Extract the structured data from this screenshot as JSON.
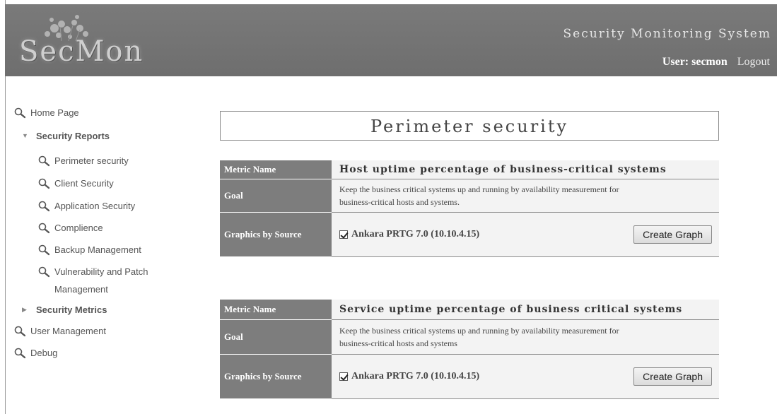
{
  "header": {
    "logo_text": "SecMon",
    "system_title": "Security Monitoring System",
    "user_label": "User: secmon",
    "logout_label": "Logout"
  },
  "sidebar": {
    "items": [
      {
        "label": "Home Page",
        "icon": "magnifier-icon"
      },
      {
        "label": "Security Reports",
        "icon": "triangle-down-icon",
        "expanded": true
      },
      {
        "label": "Perimeter security",
        "icon": "magnifier-icon"
      },
      {
        "label": "Client Security",
        "icon": "magnifier-icon"
      },
      {
        "label": "Application Security",
        "icon": "magnifier-icon"
      },
      {
        "label": "Complience",
        "icon": "magnifier-icon"
      },
      {
        "label": "Backup Management",
        "icon": "magnifier-icon"
      },
      {
        "label": "Vulnerability and Patch",
        "icon": "magnifier-icon"
      },
      {
        "label": "Management"
      },
      {
        "label": "Security Metrics",
        "icon": "triangle-right-icon",
        "expanded": false
      },
      {
        "label": "User Management",
        "icon": "magnifier-icon"
      },
      {
        "label": "Debug",
        "icon": "magnifier-icon"
      }
    ]
  },
  "main": {
    "page_title": "Perimeter security",
    "row_labels": {
      "metric_name": "Metric Name",
      "goal": "Goal",
      "graphics": "Graphics by Source"
    },
    "metrics": [
      {
        "name": "Host uptime percentage of business-critical systems",
        "goal_line1": "Keep the business critical systems up and running by availability measurement for",
        "goal_line2": "business-critical hosts and systems.",
        "source": "Ankara PRTG 7.0 (10.10.4.15)",
        "source_checked": true,
        "button": "Create Graph"
      },
      {
        "name": "Service uptime percentage of business critical systems",
        "goal_line1": "Keep the business critical systems up and running by availability measurement for",
        "goal_line2": "business-critical hosts and systems",
        "source": "Ankara PRTG 7.0 (10.10.4.15)",
        "source_checked": true,
        "button": "Create Graph"
      }
    ]
  },
  "colors": {
    "header_bg": "#757575",
    "label_bg": "#7d7d7d",
    "value_bg": "#f3f3f3"
  }
}
